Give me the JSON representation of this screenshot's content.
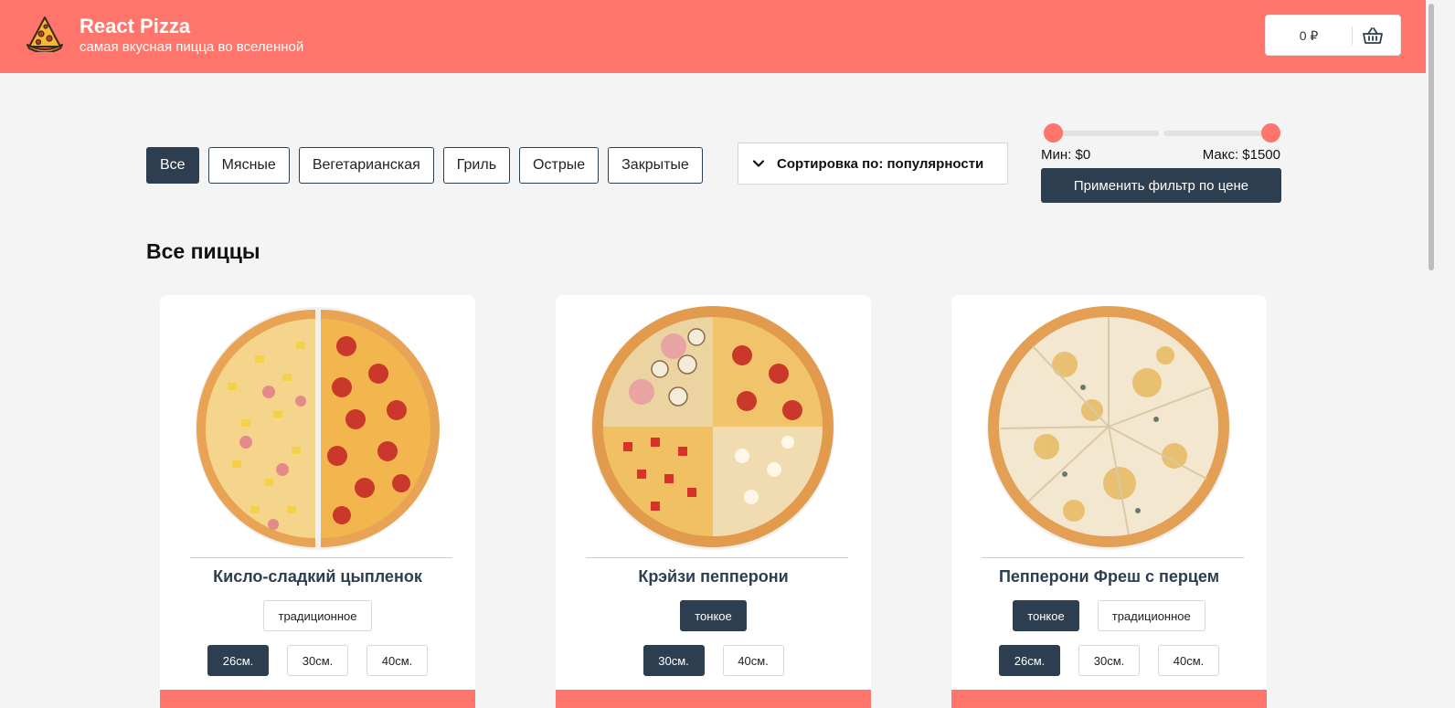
{
  "header": {
    "title": "React Pizza",
    "subtitle": "самая вкусная пицца во вселенной",
    "logo_icon": "pizza-slice-icon",
    "cart": {
      "price": "0 ₽",
      "icon": "basket-icon"
    }
  },
  "colors": {
    "brand": "#ff756b",
    "dark": "#2d3e50",
    "background": "#f4f4f4"
  },
  "categories": [
    {
      "label": "Все",
      "active": true
    },
    {
      "label": "Мясные",
      "active": false
    },
    {
      "label": "Вегетарианская",
      "active": false
    },
    {
      "label": "Гриль",
      "active": false
    },
    {
      "label": "Острые",
      "active": false
    },
    {
      "label": "Закрытые",
      "active": false
    }
  ],
  "sort": {
    "label": "Сортировка по: популярности",
    "icon": "chevron-down-icon"
  },
  "price_filter": {
    "min_label": "Мин: $0",
    "max_label": "Макс: $1500",
    "min_value": 0,
    "max_value": 1500,
    "apply_label": "Применить фильтр по цене"
  },
  "section_title": "Все пиццы",
  "pizzas": [
    {
      "name": "Кисло-сладкий цыпленок",
      "types": [
        {
          "label": "традиционное",
          "active": false
        }
      ],
      "sizes": [
        {
          "label": "26см.",
          "active": true
        },
        {
          "label": "30см.",
          "active": false
        },
        {
          "label": "40см.",
          "active": false
        }
      ]
    },
    {
      "name": "Крэйзи пепперони",
      "types": [
        {
          "label": "тонкое",
          "active": true
        }
      ],
      "sizes": [
        {
          "label": "30см.",
          "active": true
        },
        {
          "label": "40см.",
          "active": false
        }
      ]
    },
    {
      "name": "Пепперони Фреш с перцем",
      "types": [
        {
          "label": "тонкое",
          "active": true
        },
        {
          "label": "традиционное",
          "active": false
        }
      ],
      "sizes": [
        {
          "label": "26см.",
          "active": true
        },
        {
          "label": "30см.",
          "active": false
        },
        {
          "label": "40см.",
          "active": false
        }
      ]
    }
  ]
}
